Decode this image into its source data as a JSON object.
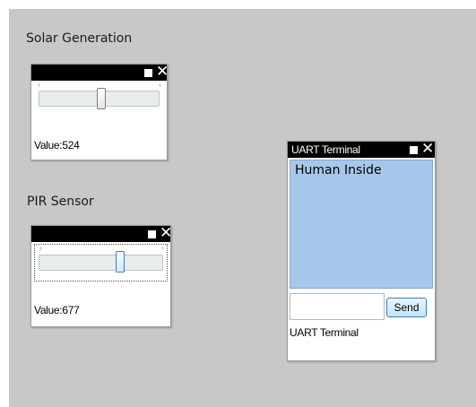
{
  "widgets": {
    "solar": {
      "label": "Solar Generation",
      "value_text": "Value:524",
      "slider_fraction": 0.51
    },
    "pir": {
      "label": "PIR Sensor",
      "value_text": "Value:677",
      "slider_fraction": 0.66
    },
    "uart": {
      "title": "UART Terminal",
      "display_text": "Human Inside",
      "input_value": "",
      "send_label": "Send",
      "footer_label": "UART Terminal"
    }
  },
  "icons": {
    "restore": "square-icon",
    "close": "close-icon"
  },
  "colors": {
    "canvas_bg": "#c8c8c8",
    "titlebar_bg": "#000000",
    "terminal_bg": "#a6c8ea",
    "button_accent": "#3c7fb1"
  }
}
